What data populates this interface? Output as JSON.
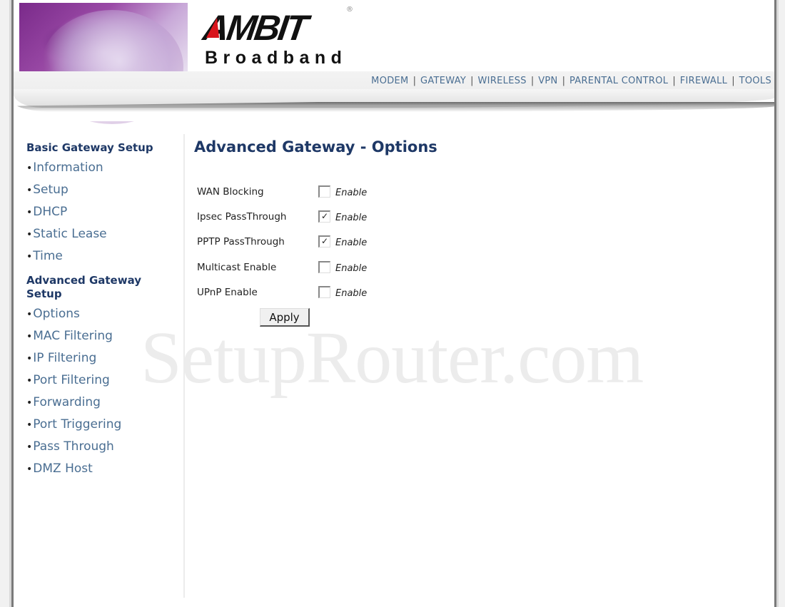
{
  "brand": {
    "logo_main": "AMBIT",
    "logo_sub": "Broadband",
    "registered_mark": "®"
  },
  "topnav": {
    "items": [
      {
        "label": "MODEM"
      },
      {
        "label": "GATEWAY"
      },
      {
        "label": "WIRELESS"
      },
      {
        "label": "VPN"
      },
      {
        "label": "PARENTAL CONTROL"
      },
      {
        "label": "FIREWALL"
      },
      {
        "label": "TOOLS"
      }
    ],
    "separator": "|"
  },
  "sidebar": {
    "bullet": "•",
    "sections": [
      {
        "heading": "Basic Gateway Setup",
        "items": [
          {
            "label": "Information"
          },
          {
            "label": "Setup"
          },
          {
            "label": "DHCP"
          },
          {
            "label": "Static Lease"
          },
          {
            "label": "Time"
          }
        ]
      },
      {
        "heading_line1": "Advanced Gateway",
        "heading_line2": "Setup",
        "items": [
          {
            "label": "Options",
            "active": true
          },
          {
            "label": "MAC Filtering"
          },
          {
            "label": "IP Filtering"
          },
          {
            "label": "Port Filtering"
          },
          {
            "label": "Forwarding"
          },
          {
            "label": "Port Triggering"
          },
          {
            "label": "Pass Through"
          },
          {
            "label": "DMZ Host"
          }
        ]
      }
    ]
  },
  "main": {
    "title": "Advanced Gateway - Options",
    "options": [
      {
        "label": "WAN Blocking",
        "checkbox_label": "Enable",
        "checked": false
      },
      {
        "label": "Ipsec PassThrough",
        "checkbox_label": "Enable",
        "checked": true
      },
      {
        "label": "PPTP PassThrough",
        "checkbox_label": "Enable",
        "checked": true
      },
      {
        "label": "Multicast Enable",
        "checkbox_label": "Enable",
        "checked": false
      },
      {
        "label": "UPnP Enable",
        "checkbox_label": "Enable",
        "checked": false
      }
    ],
    "apply_label": "Apply"
  },
  "watermark": "SetupRouter.com",
  "colors": {
    "heading": "#1e3866",
    "link": "#4a6e92"
  }
}
